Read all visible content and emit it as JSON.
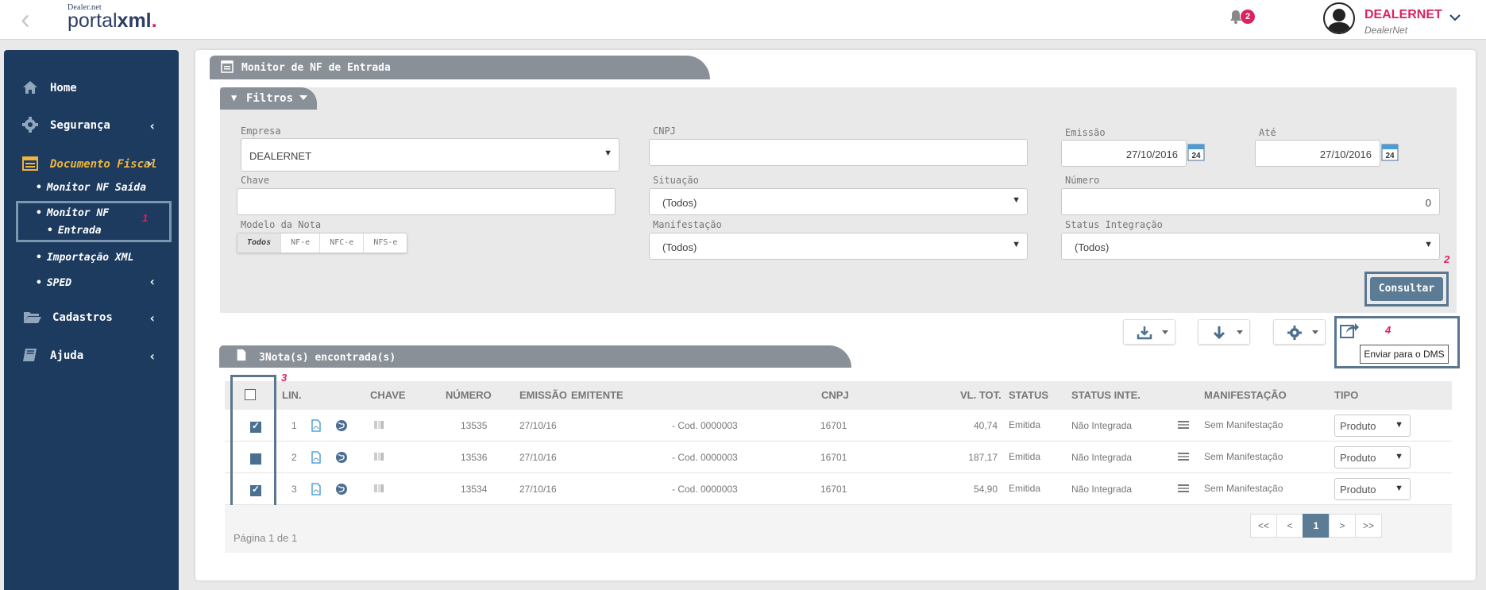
{
  "header": {
    "logo_small": "Dealer.net",
    "logo_text_regular": "portal",
    "logo_text_bold": "xml",
    "logo_dot": ".",
    "notifications_count": "2",
    "user_name": "DEALERNET",
    "user_company": "DealerNet"
  },
  "sidebar": {
    "items": [
      {
        "label": "Home"
      },
      {
        "label": "Segurança"
      },
      {
        "label": "Documento Fiscal"
      },
      {
        "label": "Cadastros"
      },
      {
        "label": "Ajuda"
      }
    ],
    "subitems": [
      {
        "label": "Monitor NF Saída"
      },
      {
        "label": "Monitor NF"
      },
      {
        "label": "Entrada"
      },
      {
        "label": "Importação XML"
      },
      {
        "label": "SPED"
      }
    ],
    "marker_1": "1"
  },
  "panel": {
    "title": "Monitor de NF de Entrada",
    "filtros_label": "Filtros"
  },
  "filters": {
    "empresa_label": "Empresa",
    "empresa_value": "DEALERNET",
    "cnpj_label": "CNPJ",
    "cnpj_value": "",
    "emissao_label": "Emissão",
    "emissao_value": "27/10/2016",
    "ate_label": "Até",
    "ate_value": "27/10/2016",
    "calendar_day": "24",
    "chave_label": "Chave",
    "chave_value": "",
    "situacao_label": "Situação",
    "situacao_value": "(Todos)",
    "numero_label": "Número",
    "numero_value": "0",
    "modelo_label": "Modelo da Nota",
    "modelo_options": [
      "Todos",
      "NF-e",
      "NFC-e",
      "NFS-e"
    ],
    "modelo_selected": "Todos",
    "manifestacao_label": "Manifestação",
    "manifestacao_value": "(Todos)",
    "status_integracao_label": "Status Integração",
    "status_integracao_value": "(Todos)",
    "consultar_label": "Consultar",
    "marker_2": "2"
  },
  "toolbar": {
    "download_icon": "download-tray-icon",
    "arrow_icon": "arrow-down-icon",
    "gear_icon": "gear-icon",
    "share_icon": "share-icon",
    "tooltip": "Enviar para o DMS",
    "marker_4": "4"
  },
  "results": {
    "title": "3Nota(s) encontrada(s)",
    "marker_3": "3",
    "columns": [
      "LIN.",
      "CHAVE",
      "NÚMERO",
      "EMISSÃO",
      "EMITENTE",
      "CNPJ",
      "VL. TOT.",
      "STATUS",
      "STATUS INTE.",
      "MANIFESTAÇÃO",
      "TIPO"
    ],
    "rows": [
      {
        "lin": "1",
        "numero": "13535",
        "emissao": "27/10/16",
        "emitente": "- Cod. 0000003",
        "cnpj": "16701",
        "vl_tot": "40,74",
        "status": "Emitida",
        "status_inte": "Não Integrada",
        "manifestacao": "Sem Manifestação",
        "tipo": "Produto",
        "checked": "checked"
      },
      {
        "lin": "2",
        "numero": "13536",
        "emissao": "27/10/16",
        "emitente": "- Cod. 0000003",
        "cnpj": "16701",
        "vl_tot": "187,17",
        "status": "Emitida",
        "status_inte": "Não Integrada",
        "manifestacao": "Sem Manifestação",
        "tipo": "Produto",
        "checked": "filled"
      },
      {
        "lin": "3",
        "numero": "13534",
        "emissao": "27/10/16",
        "emitente": "- Cod. 0000003",
        "cnpj": "16701",
        "vl_tot": "54,90",
        "status": "Emitida",
        "status_inte": "Não Integrada",
        "manifestacao": "Sem Manifestação",
        "tipo": "Produto",
        "checked": "checked"
      }
    ],
    "pagination": [
      "<<",
      "<",
      "1",
      ">",
      ">>"
    ],
    "page_info": "Página 1 de 1"
  },
  "colors": {
    "sidebar": "#1d3b5e",
    "accent": "#d9245f",
    "active_menu": "#f0b43c",
    "header_tab": "#8a9097",
    "primary_button": "#5c7c96"
  }
}
